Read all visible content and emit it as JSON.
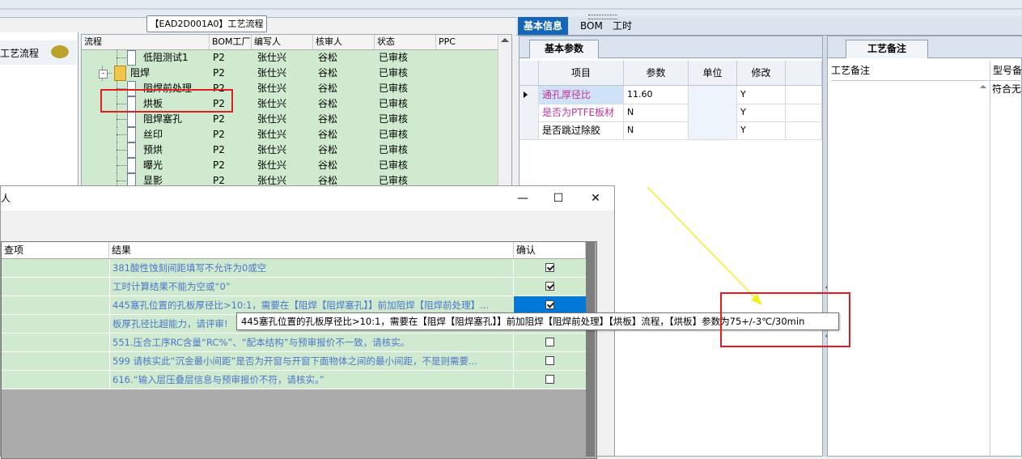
{
  "header": {
    "title": "【EAD2D001A0】工艺流程"
  },
  "left_pane": {
    "item_label": "工艺流程"
  },
  "tree_grid": {
    "columns": [
      "流程",
      "BOM工厂",
      "编写人",
      "核审人",
      "状态",
      "PPC"
    ],
    "rows": [
      {
        "name": "低阻测试1",
        "factory": "P2",
        "writer": "张仕兴",
        "reviewer": "谷松",
        "status": "已审核",
        "level": 2,
        "type": "doc"
      },
      {
        "name": "阻焊",
        "factory": "P2",
        "writer": "张仕兴",
        "reviewer": "谷松",
        "status": "已审核",
        "level": 1,
        "type": "folder"
      },
      {
        "name": "阻焊前处理",
        "factory": "P2",
        "writer": "张仕兴",
        "reviewer": "谷松",
        "status": "已审核",
        "level": 2,
        "type": "doc"
      },
      {
        "name": "烘板",
        "factory": "P2",
        "writer": "张仕兴",
        "reviewer": "谷松",
        "status": "已审核",
        "level": 2,
        "type": "doc"
      },
      {
        "name": "阻焊塞孔",
        "factory": "P2",
        "writer": "张仕兴",
        "reviewer": "谷松",
        "status": "已审核",
        "level": 2,
        "type": "doc"
      },
      {
        "name": "丝印",
        "factory": "P2",
        "writer": "张仕兴",
        "reviewer": "谷松",
        "status": "已审核",
        "level": 2,
        "type": "doc"
      },
      {
        "name": "预烘",
        "factory": "P2",
        "writer": "张仕兴",
        "reviewer": "谷松",
        "status": "已审核",
        "level": 2,
        "type": "doc"
      },
      {
        "name": "曝光",
        "factory": "P2",
        "writer": "张仕兴",
        "reviewer": "谷松",
        "status": "已审核",
        "level": 2,
        "type": "doc"
      },
      {
        "name": "显影",
        "factory": "P2",
        "writer": "张仕兴",
        "reviewer": "谷松",
        "status": "已审核",
        "level": 2,
        "type": "doc"
      }
    ]
  },
  "right_tabs": [
    {
      "label": "基本信息",
      "active": true
    },
    {
      "label": "BOM",
      "active": false
    },
    {
      "label": "工时",
      "active": false
    }
  ],
  "params": {
    "tab_label": "基本参数",
    "columns": [
      "项目",
      "参数",
      "单位",
      "修改"
    ],
    "rows": [
      {
        "item": "通孔厚径比",
        "value": "11.60",
        "unit": "",
        "modify": "Y",
        "item_color": "#c0349a",
        "highlight": true
      },
      {
        "item": "是否为PTFE板材",
        "value": "N",
        "unit": "",
        "modify": "Y",
        "item_color": "#c0349a",
        "highlight": false
      },
      {
        "item": "是否跳过除胶",
        "value": "N",
        "unit": "",
        "modify": "Y",
        "item_color": "#000000",
        "highlight": false
      }
    ]
  },
  "remarks": {
    "tab_label": "工艺备注",
    "col1": "工艺备注",
    "col2": "型号备注",
    "col2_value": "符合无"
  },
  "dialog": {
    "title": "人",
    "columns": [
      "查项",
      "结果",
      "确认"
    ],
    "rows": [
      {
        "result": "381酸性蚀刻间距填写不允许为0或空",
        "checked": true,
        "selected": false
      },
      {
        "result": "工时计算结果不能为空或“0”",
        "checked": true,
        "selected": false
      },
      {
        "result": "445塞孔位置的孔板厚径比>10:1，需要在【阻焊【阻焊塞孔】】前加阻焊【阻焊前处理】...",
        "checked": true,
        "selected": true
      },
      {
        "result": "板厚孔径比超能力，请评审!",
        "checked": false,
        "selected": false
      },
      {
        "result": "551.压合工序RC含量“RC%”、“配本结构”与预审报价不一致，请核实。",
        "checked": false,
        "selected": false
      },
      {
        "result": "599 请核实此“沉金最小间距”是否为开窗与开窗下面物体之间的最小间距，不是则需要...",
        "checked": false,
        "selected": false
      },
      {
        "result": "616.“输入层压叠层信息与预审报价不符，请核实。”",
        "checked": false,
        "selected": false
      }
    ],
    "buttons": {
      "minimize": "—",
      "maximize": "☐",
      "close": "✕"
    }
  },
  "tooltip": {
    "text": "445塞孔位置的孔板厚径比>10:1，需要在【阻焊【阻焊塞孔】】前加阻焊【阻焊前处理】【烘板】流程，【烘板】参数为75+/-3℃/30min"
  },
  "colors": {
    "accent": "#1566b6",
    "row_green": "#cfeacf",
    "link_blue": "#4a77c9",
    "annotation_red": "#e02020",
    "arrow_yellow": "#f2ef2a"
  }
}
